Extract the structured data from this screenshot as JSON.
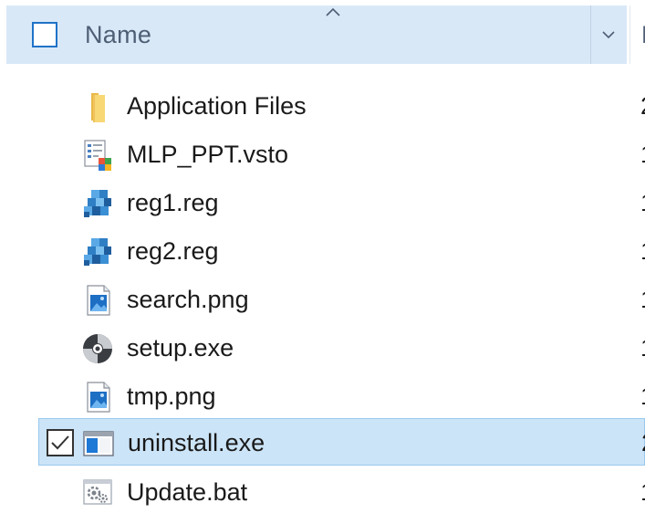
{
  "header": {
    "name_label": "Name",
    "next_column_label": "D"
  },
  "files": [
    {
      "name": "Application Files",
      "icon": "folder-icon",
      "next_col": "2",
      "selected": false
    },
    {
      "name": "MLP_PPT.vsto",
      "icon": "vsto-manifest-icon",
      "next_col": "1",
      "selected": false
    },
    {
      "name": "reg1.reg",
      "icon": "registry-file-icon",
      "next_col": "1",
      "selected": false
    },
    {
      "name": "reg2.reg",
      "icon": "registry-file-icon",
      "next_col": "1",
      "selected": false
    },
    {
      "name": "search.png",
      "icon": "image-file-icon",
      "next_col": "1",
      "selected": false
    },
    {
      "name": "setup.exe",
      "icon": "setup-disc-icon",
      "next_col": "1",
      "selected": false
    },
    {
      "name": "tmp.png",
      "icon": "image-file-icon",
      "next_col": "1",
      "selected": false
    },
    {
      "name": "uninstall.exe",
      "icon": "application-window-icon",
      "next_col": "2",
      "selected": true
    },
    {
      "name": "Update.bat",
      "icon": "batch-file-gear-icon",
      "next_col": "1",
      "selected": false
    }
  ],
  "colors": {
    "header_bg": "#d9e8f7",
    "selected_bg": "#cce4f7",
    "selected_border": "#99c9ef",
    "folder_yellow": "#f8d775",
    "accent_blue": "#1f73c7"
  }
}
